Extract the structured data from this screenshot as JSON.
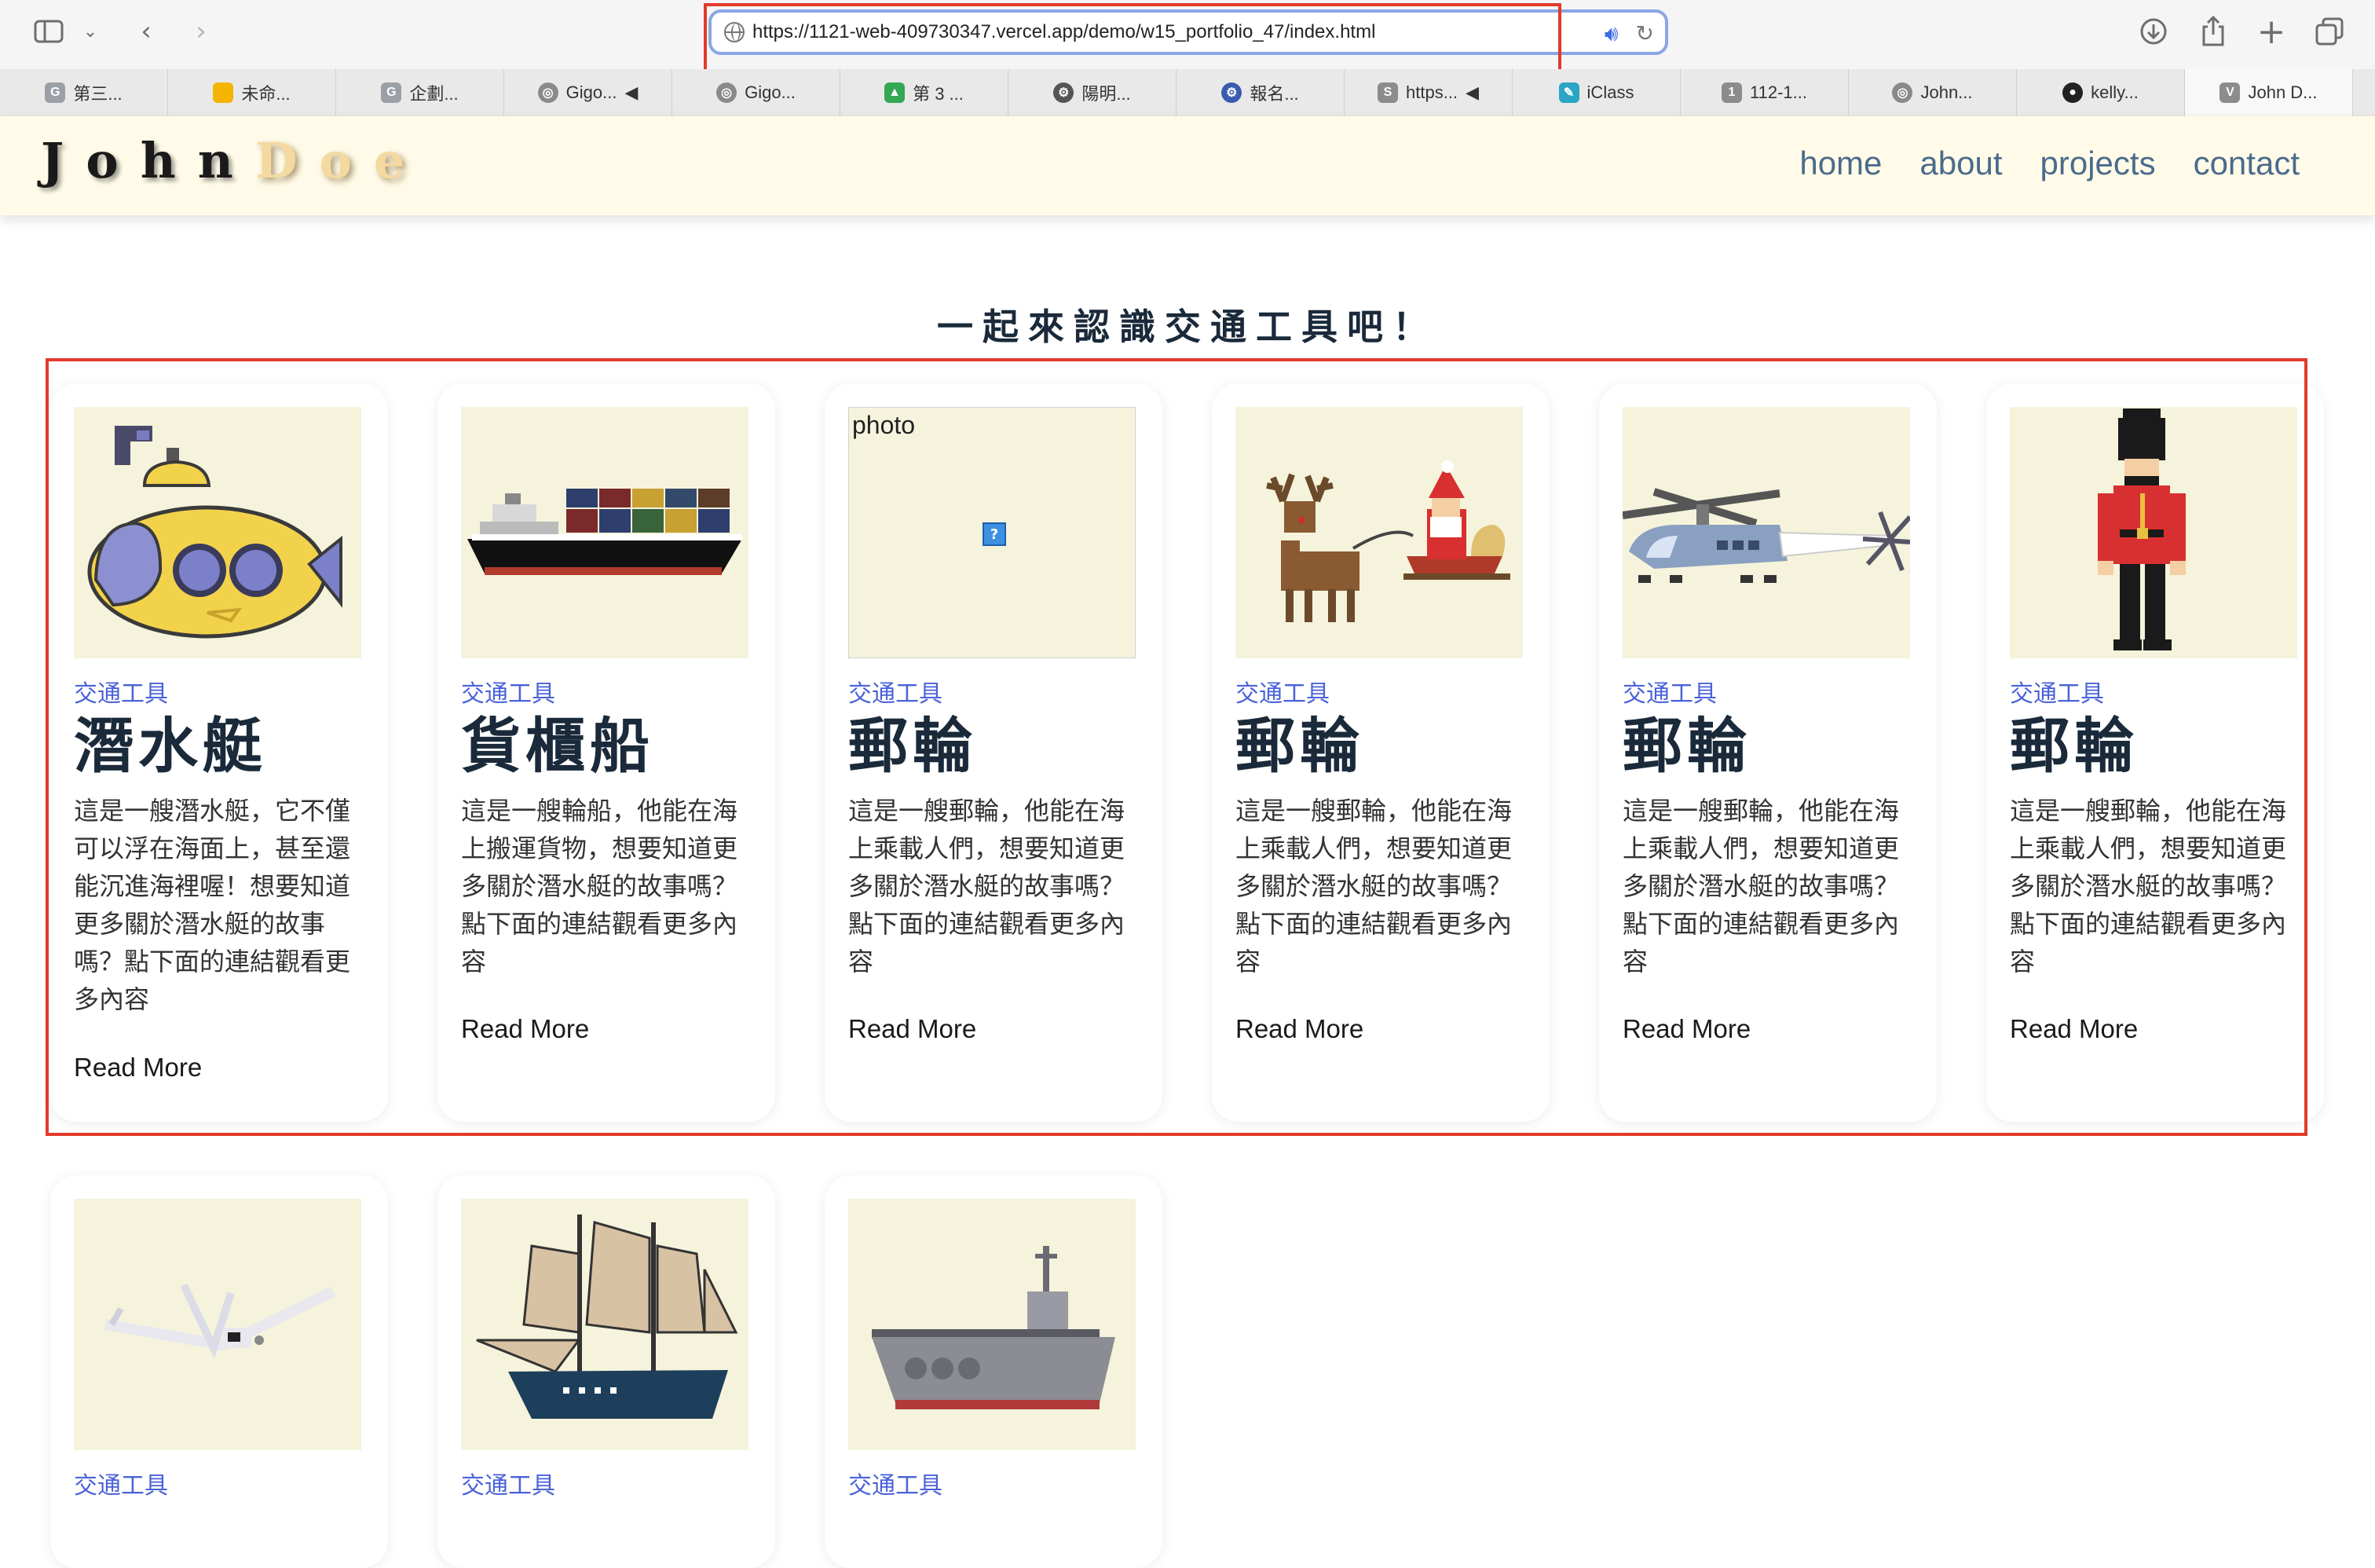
{
  "browser": {
    "url": "https://1121-web-409730347.vercel.app/demo/w15_portfolio_47/index.html",
    "tabs": [
      {
        "label": "第三...",
        "icon": "google-icon",
        "color": "#9aa0a6",
        "glyph": "G"
      },
      {
        "label": "未命...",
        "icon": "slides-icon",
        "color": "#f4b400",
        "glyph": ""
      },
      {
        "label": "企劃...",
        "icon": "google-icon",
        "color": "#9aa0a6",
        "glyph": "G"
      },
      {
        "label": "Gigo...",
        "icon": "compass-icon",
        "color": "#8a8a8a",
        "glyph": "◎"
      },
      {
        "label": "Gigo...",
        "icon": "compass-icon",
        "color": "#8a8a8a",
        "glyph": "◎"
      },
      {
        "label": "第 3 ...",
        "icon": "drive-icon",
        "color": "#34a853",
        "glyph": "▲"
      },
      {
        "label": "陽明...",
        "icon": "university-icon",
        "color": "#555555",
        "glyph": "⚙"
      },
      {
        "label": "報名...",
        "icon": "university-icon",
        "color": "#3b5bb0",
        "glyph": "⚙"
      },
      {
        "label": "https...",
        "icon": "s-icon",
        "color": "#8c8c8c",
        "glyph": "S"
      },
      {
        "label": "iClass",
        "icon": "iclass-icon",
        "color": "#2aa6c4",
        "glyph": "✎"
      },
      {
        "label": "112-1...",
        "icon": "number-icon",
        "color": "#8c8c8c",
        "glyph": "1"
      },
      {
        "label": "John...",
        "icon": "compass-icon",
        "color": "#8a8a8a",
        "glyph": "◎"
      },
      {
        "label": "kelly...",
        "icon": "github-icon",
        "color": "#222222",
        "glyph": "●"
      },
      {
        "label": "John D...",
        "icon": "vercel-icon",
        "color": "#8c8c8c",
        "glyph": "V"
      }
    ]
  },
  "site": {
    "logo_first": "John",
    "logo_second": "Doe",
    "nav": [
      "home",
      "about",
      "projects",
      "contact"
    ]
  },
  "section": {
    "title": "一起來認識交通工具吧！"
  },
  "cards": [
    {
      "category": "交通工具",
      "title": "潛水艇",
      "description": "這是一艘潛水艇，它不僅可以浮在海面上，甚至還能沉進海裡喔！想要知道更多關於潛水艇的故事嗎？點下面的連結觀看更多內容",
      "link": "Read More",
      "image": "submarine"
    },
    {
      "category": "交通工具",
      "title": "貨櫃船",
      "description": "這是一艘輪船，他能在海上搬運貨物，想要知道更多關於潛水艇的故事嗎？點下面的連結觀看更多內容",
      "link": "Read More",
      "image": "cargo-ship"
    },
    {
      "category": "交通工具",
      "title": "郵輪",
      "description": "這是一艘郵輪，他能在海上乘載人們，想要知道更多關於潛水艇的故事嗎？點下面的連結觀看更多內容",
      "link": "Read More",
      "image": "broken",
      "image_alt": "photo"
    },
    {
      "category": "交通工具",
      "title": "郵輪",
      "description": "這是一艘郵輪，他能在海上乘載人們，想要知道更多關於潛水艇的故事嗎？點下面的連結觀看更多內容",
      "link": "Read More",
      "image": "sleigh"
    },
    {
      "category": "交通工具",
      "title": "郵輪",
      "description": "這是一艘郵輪，他能在海上乘載人們，想要知道更多關於潛水艇的故事嗎？點下面的連結觀看更多內容",
      "link": "Read More",
      "image": "helicopter"
    },
    {
      "category": "交通工具",
      "title": "郵輪",
      "description": "這是一艘郵輪，他能在海上乘載人們，想要知道更多關於潛水艇的故事嗎？點下面的連結觀看更多內容",
      "link": "Read More",
      "image": "guard"
    },
    {
      "category": "交通工具",
      "title": "",
      "description": "",
      "link": "",
      "image": "airplane"
    },
    {
      "category": "交通工具",
      "title": "",
      "description": "",
      "link": "",
      "image": "sailing-ship"
    },
    {
      "category": "交通工具",
      "title": "",
      "description": "",
      "link": "",
      "image": "battleship"
    }
  ]
}
